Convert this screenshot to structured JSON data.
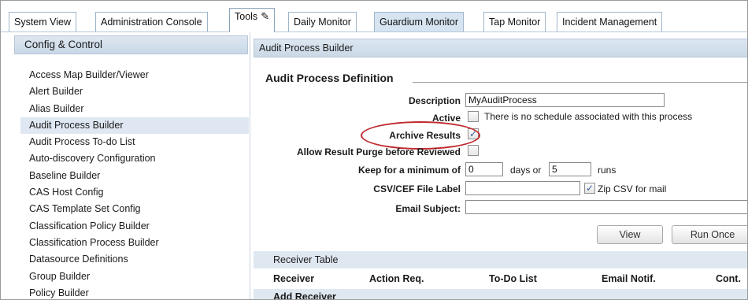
{
  "tabs": [
    {
      "label": "System View"
    },
    {
      "label": "Administration Console"
    },
    {
      "label": "Tools"
    },
    {
      "label": "Daily Monitor"
    },
    {
      "label": "Guardium Monitor"
    },
    {
      "label": "Tap Monitor"
    },
    {
      "label": "Incident Management"
    }
  ],
  "sidebar": {
    "header": "Config & Control",
    "items": [
      {
        "label": "Access Map Builder/Viewer"
      },
      {
        "label": "Alert Builder"
      },
      {
        "label": "Alias Builder"
      },
      {
        "label": "Audit Process Builder"
      },
      {
        "label": "Audit Process To-do List"
      },
      {
        "label": "Auto-discovery Configuration"
      },
      {
        "label": "Baseline Builder"
      },
      {
        "label": "CAS Host Config"
      },
      {
        "label": "CAS Template Set Config"
      },
      {
        "label": "Classification Policy Builder"
      },
      {
        "label": "Classification Process Builder"
      },
      {
        "label": "Datasource Definitions"
      },
      {
        "label": "Group Builder"
      },
      {
        "label": "Policy Builder"
      }
    ]
  },
  "main": {
    "header": "Audit Process Builder",
    "section_title": "Audit Process Definition",
    "form": {
      "description_label": "Description",
      "description_value": "MyAuditProcess",
      "active_label": "Active",
      "active_note": "There is no schedule associated with this process",
      "archive_label": "Archive Results",
      "archive_checked": "✓",
      "purge_label": "Allow Result Purge before Reviewed",
      "keep_label": "Keep for a minimum of",
      "keep_days_value": "0",
      "days_or": "days or",
      "keep_runs_value": "5",
      "runs": "runs",
      "csv_label": "CSV/CEF File Label",
      "csv_value": "",
      "zip_checked": "✓",
      "zip_label": "Zip CSV for mail",
      "email_label": "Email Subject:",
      "email_value": ""
    },
    "buttons": {
      "view": "View",
      "run_once": "Run Once"
    },
    "receiver_table": {
      "title": "Receiver Table",
      "columns": [
        "Receiver",
        "Action Req.",
        "To-Do List",
        "Email Notif.",
        "Cont."
      ]
    },
    "add_receiver": "Add Receiver"
  },
  "icons": {
    "tools_tab": "pencil-icon"
  },
  "colors": {
    "header_bg": "#d6e4f1",
    "highlight_oval": "#c0282d",
    "selected_item": "#dfe8f2"
  }
}
